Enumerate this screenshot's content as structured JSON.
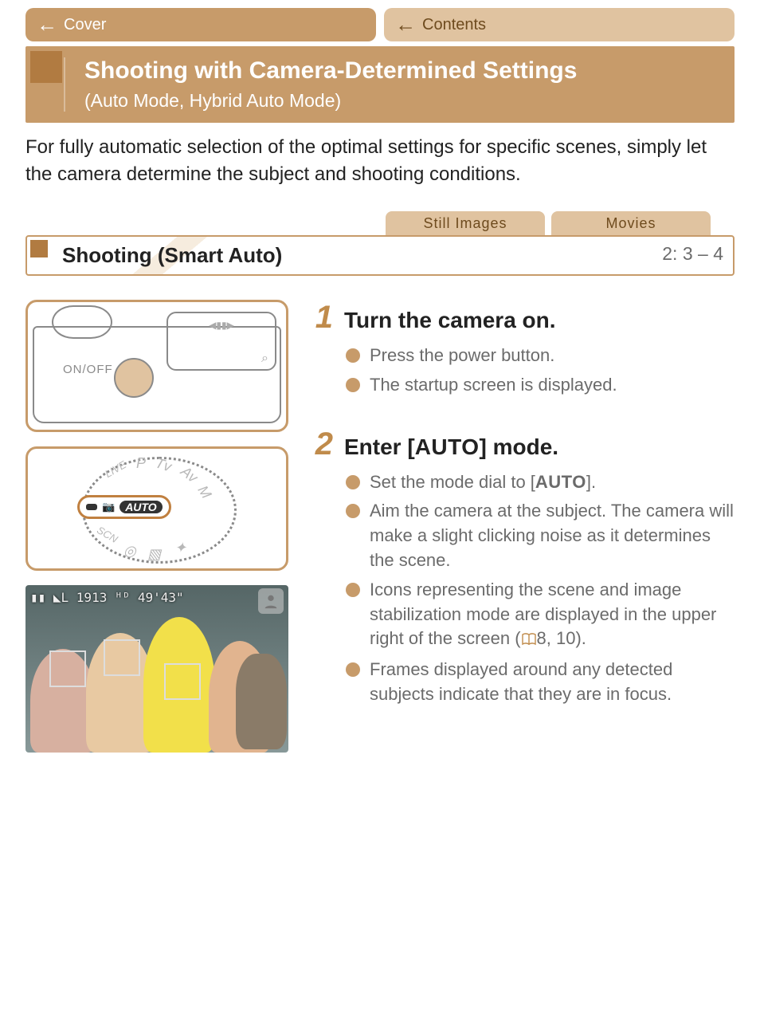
{
  "breadcrumbs": {
    "crumb1": "Cover",
    "crumb2": "Contents"
  },
  "main_heading": {
    "title": "Shooting with Camera-Determined Settings",
    "subtitle": "(Auto Mode, Hybrid Auto Mode)"
  },
  "intro": "For fully automatic selection of the optimal settings for specific scenes, simply let the camera determine the subject and shooting conditions.",
  "tabs": {
    "still": "Still Images",
    "movie": "Movies"
  },
  "sub_heading": {
    "title": "Shooting (Smart Auto)",
    "xref_before": "2: ",
    "xref_pages": "3 – 4"
  },
  "illustrations": {
    "onoff_label": "ON/OFF",
    "dial_auto_label": "AUTO",
    "screen_osd": "▮▮ ◣L 1913  ᴴᴰ 49'43\"",
    "indicator_icon": "person-icon"
  },
  "steps": [
    {
      "num": "1",
      "title_before": "Turn the camera on.",
      "title_auto": "",
      "title_after": "",
      "bullets": [
        {
          "text": "Press the power button."
        },
        {
          "text": "The startup screen is displayed."
        }
      ]
    },
    {
      "num": "2",
      "title_before": "Enter [",
      "title_auto": "AUTO",
      "title_after": "] mode.",
      "bullets": [
        {
          "pre": "Set the mode dial to [",
          "auto": "AUTO",
          "post": "]."
        },
        {
          "text": "Aim the camera at the subject. The camera will make a slight clicking noise as it determines the scene."
        },
        {
          "pre": "Icons representing the scene and image stabilization mode are displayed in the upper right of the screen (",
          "book": true,
          "post": "8, 10)."
        },
        {
          "text": "Frames displayed around any detected subjects indicate that they are in focus."
        }
      ]
    }
  ]
}
